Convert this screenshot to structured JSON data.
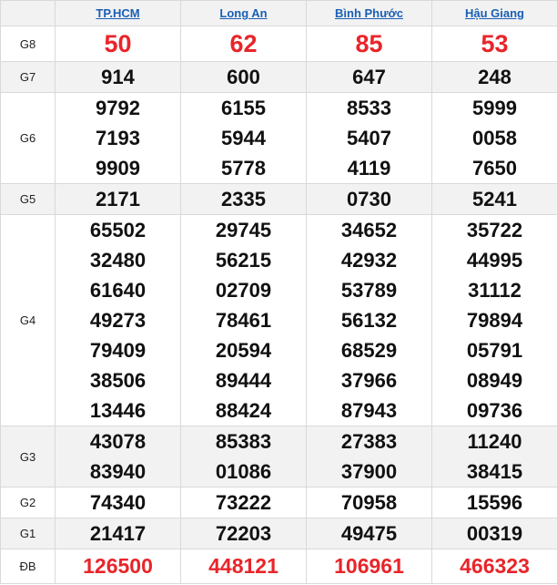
{
  "provinces": [
    "TP.HCM",
    "Long An",
    "Bình Phước",
    "Hậu Giang"
  ],
  "prizes": [
    {
      "label": "G8",
      "values": [
        [
          "50"
        ],
        [
          "62"
        ],
        [
          "85"
        ],
        [
          "53"
        ]
      ]
    },
    {
      "label": "G7",
      "values": [
        [
          "914"
        ],
        [
          "600"
        ],
        [
          "647"
        ],
        [
          "248"
        ]
      ]
    },
    {
      "label": "G6",
      "values": [
        [
          "9792",
          "7193",
          "9909"
        ],
        [
          "6155",
          "5944",
          "5778"
        ],
        [
          "8533",
          "5407",
          "4119"
        ],
        [
          "5999",
          "0058",
          "7650"
        ]
      ]
    },
    {
      "label": "G5",
      "values": [
        [
          "2171"
        ],
        [
          "2335"
        ],
        [
          "0730"
        ],
        [
          "5241"
        ]
      ]
    },
    {
      "label": "G4",
      "values": [
        [
          "65502",
          "32480",
          "61640",
          "49273",
          "79409",
          "38506",
          "13446"
        ],
        [
          "29745",
          "56215",
          "02709",
          "78461",
          "20594",
          "89444",
          "88424"
        ],
        [
          "34652",
          "42932",
          "53789",
          "56132",
          "68529",
          "37966",
          "87943"
        ],
        [
          "35722",
          "44995",
          "31112",
          "79894",
          "05791",
          "08949",
          "09736"
        ]
      ]
    },
    {
      "label": "G3",
      "values": [
        [
          "43078",
          "83940"
        ],
        [
          "85383",
          "01086"
        ],
        [
          "27383",
          "37900"
        ],
        [
          "11240",
          "38415"
        ]
      ]
    },
    {
      "label": "G2",
      "values": [
        [
          "74340"
        ],
        [
          "73222"
        ],
        [
          "70958"
        ],
        [
          "15596"
        ]
      ]
    },
    {
      "label": "G1",
      "values": [
        [
          "21417"
        ],
        [
          "72203"
        ],
        [
          "49475"
        ],
        [
          "00319"
        ]
      ]
    },
    {
      "label": "ĐB",
      "values": [
        [
          "126500"
        ],
        [
          "448121"
        ],
        [
          "106961"
        ],
        [
          "466323"
        ]
      ]
    }
  ]
}
